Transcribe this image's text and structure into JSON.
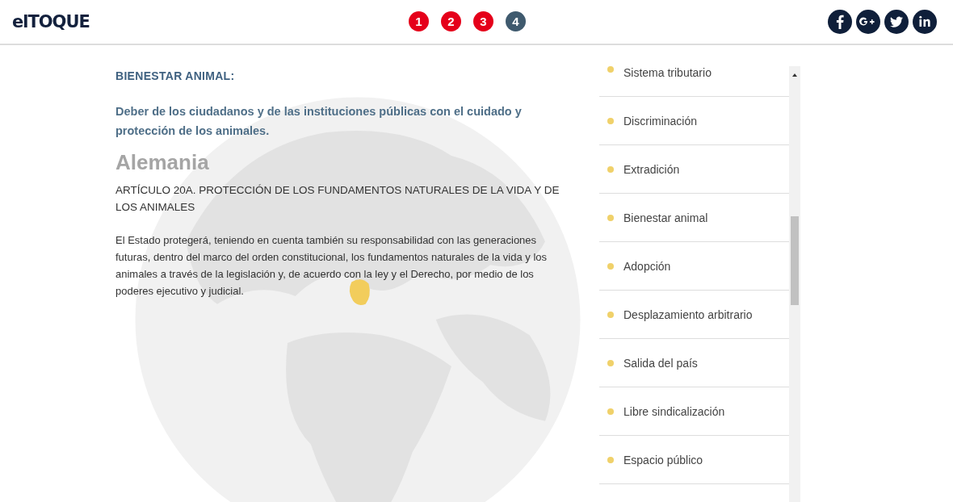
{
  "header": {
    "logo": "elTOQUE",
    "steps": [
      {
        "label": "1",
        "selected": false
      },
      {
        "label": "2",
        "selected": false
      },
      {
        "label": "3",
        "selected": false
      },
      {
        "label": "4",
        "selected": true
      }
    ]
  },
  "article": {
    "category": "BIENESTAR ANIMAL:",
    "definition": "Deber de los ciudadanos y de las instituciones públicas con el cuidado y protección de los animales.",
    "country": "Alemania",
    "article_title": "ARTÍCULO 20A. PROTECCIÓN DE LOS FUNDAMENTOS NATURALES DE LA VIDA Y DE LOS ANIMALES",
    "body": "El Estado protegerá, teniendo en cuenta también su responsabilidad con las generaciones futuras, dentro del marco del orden constitucional, los fundamentos naturales de la vida y los animales a través de la legislación y, de acuerdo con la ley y el Derecho, por medio de los poderes ejecutivo y judicial."
  },
  "topics": [
    "Sistema tributario",
    "Discriminación",
    "Extradición",
    "Bienestar animal",
    "Adopción",
    "Desplazamiento arbitrario",
    "Salida del país",
    "Libre sindicalización",
    "Espacio público"
  ]
}
